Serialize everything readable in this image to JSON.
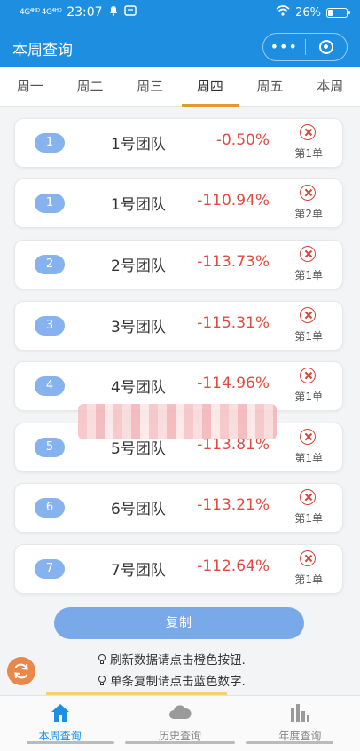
{
  "status": {
    "signal": "4G⁴ᴴᴰ 4G⁴ᴴᴰ",
    "time": "23:07",
    "battery": "26%",
    "battery_level": 0.26
  },
  "header": {
    "title": "本周查询"
  },
  "tabs": [
    {
      "label": "周一",
      "active": false
    },
    {
      "label": "周二",
      "active": false
    },
    {
      "label": "周三",
      "active": false
    },
    {
      "label": "周四",
      "active": true
    },
    {
      "label": "周五",
      "active": false
    },
    {
      "label": "本周",
      "active": false
    }
  ],
  "rows": [
    {
      "rank": "1",
      "team": "1号团队",
      "pct": "-0.50%",
      "order": "第1单"
    },
    {
      "rank": "1",
      "team": "1号团队",
      "pct": "-110.94%",
      "order": "第2单"
    },
    {
      "rank": "2",
      "team": "2号团队",
      "pct": "-113.73%",
      "order": "第1单"
    },
    {
      "rank": "3",
      "team": "3号团队",
      "pct": "-115.31%",
      "order": "第1单"
    },
    {
      "rank": "4",
      "team": "4号团队",
      "pct": "-114.96%",
      "order": "第1单"
    },
    {
      "rank": "5",
      "team": "5号团队",
      "pct": "-113.81%",
      "order": "第1单"
    },
    {
      "rank": "6",
      "team": "6号团队",
      "pct": "-113.21%",
      "order": "第1单"
    },
    {
      "rank": "7",
      "team": "7号团队",
      "pct": "-112.64%",
      "order": "第1单"
    }
  ],
  "copy_button": "复制",
  "tips": [
    "刷新数据请点击橙色按钮.",
    "单条复制请点击蓝色数字."
  ],
  "bottom_nav": [
    {
      "label": "本周查询",
      "icon": "home-icon",
      "active": true
    },
    {
      "label": "历史查询",
      "icon": "cloud-icon",
      "active": false
    },
    {
      "label": "年度查询",
      "icon": "bar-chart-icon",
      "active": false
    }
  ],
  "colors": {
    "primary": "#1e8fe0",
    "tab_indicator": "#e39a2d",
    "negative": "#e04a3f",
    "pill": "#86b3ee",
    "refresh": "#e8884b"
  }
}
